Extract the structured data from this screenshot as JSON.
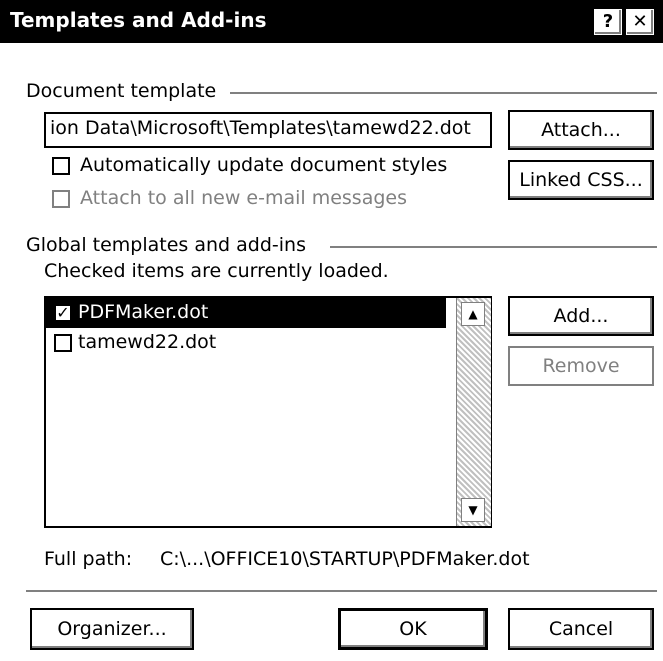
{
  "window": {
    "title": "Templates and Add-ins",
    "help_label": "?",
    "close_label": "✕"
  },
  "document_template": {
    "group_label": "Document template",
    "path_value": "ion Data\\Microsoft\\Templates\\tamewd22.dot",
    "attach_button": "Attach...",
    "linked_css_button": "Linked CSS...",
    "auto_update": {
      "label": "Automatically update document styles",
      "checked": false
    },
    "attach_email": {
      "label": "Attach to all new e-mail messages",
      "checked": false,
      "enabled": false
    }
  },
  "global_templates": {
    "group_label": "Global templates and add-ins",
    "hint": "Checked items are currently loaded.",
    "items": [
      {
        "label": "PDFMaker.dot",
        "checked": true,
        "selected": true
      },
      {
        "label": "tamewd22.dot",
        "checked": false,
        "selected": false
      }
    ],
    "add_button": "Add...",
    "remove_button": "Remove",
    "full_path_label": "Full path:",
    "full_path_value": "C:\\...\\OFFICE10\\STARTUP\\PDFMaker.dot"
  },
  "footer": {
    "organizer_button": "Organizer...",
    "ok_button": "OK",
    "cancel_button": "Cancel"
  },
  "icons": {
    "check": "✓",
    "scroll_up": "▲",
    "scroll_down": "▼"
  }
}
